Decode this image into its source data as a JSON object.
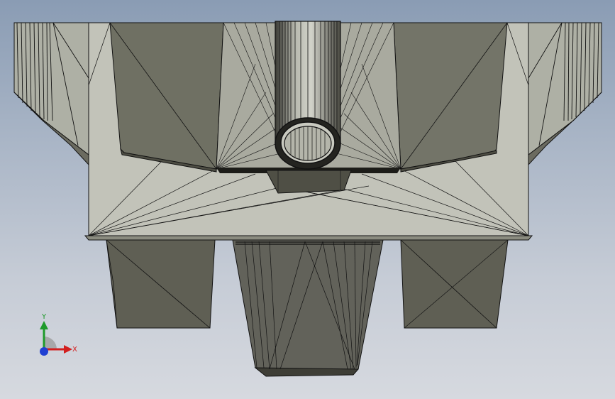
{
  "viewport": {
    "background_top": "#8a9cb4",
    "background_bottom": "#d6d9df"
  },
  "model": {
    "description_icon": "cad-mesh-model",
    "colors": {
      "face_light": "#c2c3b9",
      "face_mid": "#a9aa9f",
      "face_dark": "#6f7063",
      "face_darker": "#5b5b4f",
      "edge": "#121212"
    }
  },
  "triad": {
    "x_label": "X",
    "y_label": "Y",
    "x_color": "#d21f1f",
    "y_color": "#1e9a2a",
    "z_color": "#1f3fd2"
  }
}
